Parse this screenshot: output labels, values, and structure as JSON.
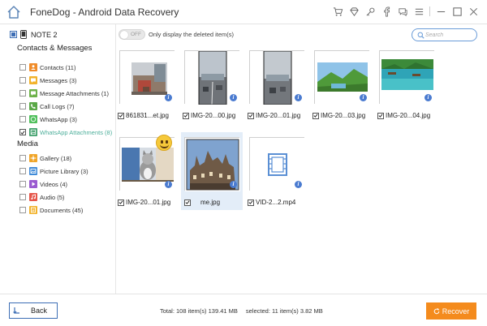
{
  "window": {
    "title": "FoneDog - Android Data Recovery"
  },
  "device": {
    "name": "NOTE 2"
  },
  "sidebar": {
    "groups": [
      {
        "title": "Contacts & Messages",
        "items": [
          {
            "label": "Contacts (11)",
            "icon": "contacts-icon",
            "color": "#f08c2a",
            "checked": false
          },
          {
            "label": "Messages (3)",
            "icon": "messages-icon",
            "color": "#f2b32c",
            "checked": false
          },
          {
            "label": "Message Attachments (1)",
            "icon": "attachment-icon",
            "color": "#6eb24a",
            "checked": false
          },
          {
            "label": "Call Logs (7)",
            "icon": "phone-icon",
            "color": "#5aa847",
            "checked": false
          },
          {
            "label": "WhatsApp (3)",
            "icon": "whatsapp-icon",
            "color": "#4fbf5b",
            "checked": false
          },
          {
            "label": "WhatsApp Attachments (8)",
            "icon": "whatsapp-attachment-icon",
            "color": "#3f9f6a",
            "checked": true,
            "active": true
          }
        ]
      },
      {
        "title": "Media",
        "items": [
          {
            "label": "Gallery (18)",
            "icon": "gallery-icon",
            "color": "#f0a529",
            "checked": false
          },
          {
            "label": "Picture Library (3)",
            "icon": "picture-library-icon",
            "color": "#3f8ad8",
            "checked": false
          },
          {
            "label": "Videos (4)",
            "icon": "video-icon",
            "color": "#9a5ad0",
            "checked": false
          },
          {
            "label": "Audio (5)",
            "icon": "audio-icon",
            "color": "#e5564a",
            "checked": false
          },
          {
            "label": "Documents (45)",
            "icon": "documents-icon",
            "color": "#f2b32c",
            "checked": false
          }
        ]
      }
    ]
  },
  "filter": {
    "toggle_label": "OFF",
    "label": "Only display the deleted item(s)",
    "search_placeholder": "Search"
  },
  "files": [
    {
      "name": "861831...et.jpg",
      "checked": true,
      "thumb": "street"
    },
    {
      "name": "IMG-20...00.jpg",
      "checked": true,
      "thumb": "road"
    },
    {
      "name": "IMG-20...01.jpg",
      "checked": true,
      "thumb": "road2"
    },
    {
      "name": "IMG-20...03.jpg",
      "checked": true,
      "thumb": "landscape"
    },
    {
      "name": "IMG-20...04.jpg",
      "checked": true,
      "thumb": "beach"
    },
    {
      "name": "IMG-20...01.jpg",
      "checked": true,
      "thumb": "cat"
    },
    {
      "name": "me.jpg",
      "checked": true,
      "thumb": "castle",
      "selected": true
    },
    {
      "name": "VID-2...2.mp4",
      "checked": true,
      "thumb": "video"
    }
  ],
  "footer": {
    "back_label": "Back",
    "total_text": "Total: 108 item(s) 139.41 MB",
    "selected_text": "selected: 11 item(s) 3.82 MB",
    "recover_label": "Recover"
  },
  "colors": {
    "accent": "#3d6eb5",
    "recover": "#f48b1d",
    "active_text": "#4cae9a"
  }
}
